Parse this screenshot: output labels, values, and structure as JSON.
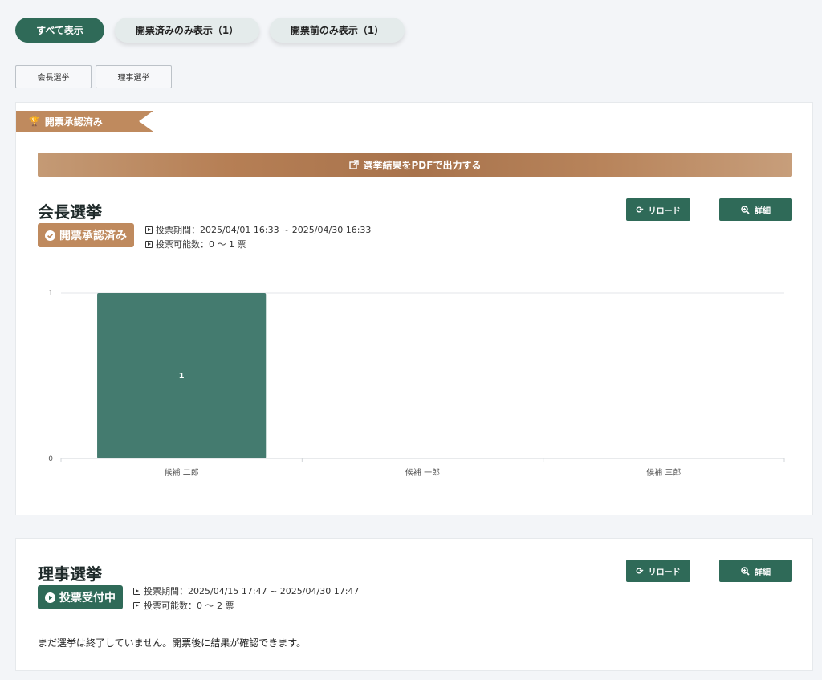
{
  "filters": {
    "all": "すべて表示",
    "counted_only": "開票済みのみ表示（1）",
    "before_only": "開票前のみ表示（1）"
  },
  "election_links": [
    "会長選挙",
    "理事選挙"
  ],
  "card1": {
    "ribbon_label": "開票承認済み",
    "pdf_button": "選挙結果をPDFで出力する",
    "title": "会長選挙",
    "status": "開票承認済み",
    "period": "投票期間：2025/04/01 16:33 ~ 2025/04/30 16:33",
    "vote_count": "投票可能数：0 〜 1 票",
    "reload": "リロード",
    "detail": "詳細"
  },
  "card2": {
    "title": "理事選挙",
    "status": "投票受付中",
    "period": "投票期間：2025/04/15 17:47 ~ 2025/04/30 17:47",
    "vote_count": "投票可能数：0 〜 2 票",
    "reload": "リロード",
    "detail": "詳細",
    "message": "まだ選挙は終了していません。開票後に結果が確認できます。"
  },
  "colors": {
    "primary": "#2f6a58",
    "bar": "#447b6f",
    "accent": "#bf8a5e"
  },
  "chart_data": {
    "type": "bar",
    "categories": [
      "候補 二郎",
      "候補 一郎",
      "候補 三郎"
    ],
    "values": [
      1,
      0,
      0
    ],
    "data_labels": [
      "1",
      "",
      ""
    ],
    "ylim": [
      0,
      1
    ],
    "yticks": [
      "0",
      "1"
    ],
    "grid": true
  }
}
